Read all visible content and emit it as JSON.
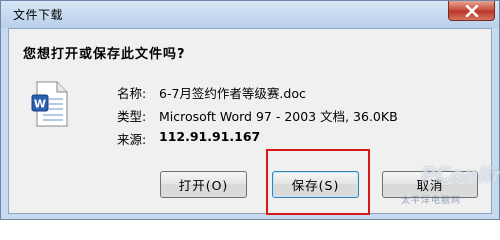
{
  "window": {
    "title": "文件下载",
    "close_icon": "close-icon"
  },
  "dialog": {
    "prompt": "您想打开或保存此文件吗?",
    "file_icon": "word-document-icon",
    "fields": [
      {
        "label": "名称:",
        "value": "6-7月签约作者等级赛.doc"
      },
      {
        "label": "类型:",
        "value": "Microsoft Word 97 - 2003 文档, 36.0KB"
      },
      {
        "label": "来源:",
        "value": "112.91.91.167"
      }
    ]
  },
  "buttons": {
    "open_label": "打开(O)",
    "save_label": "保存(S)",
    "cancel_label": "取消"
  },
  "watermark": {
    "brand": "PConline",
    "sub": "太平洋电脑网"
  },
  "colors": {
    "highlight": "#d61a1a",
    "close_button": "#c9513f",
    "frame": "#c7dbef"
  }
}
